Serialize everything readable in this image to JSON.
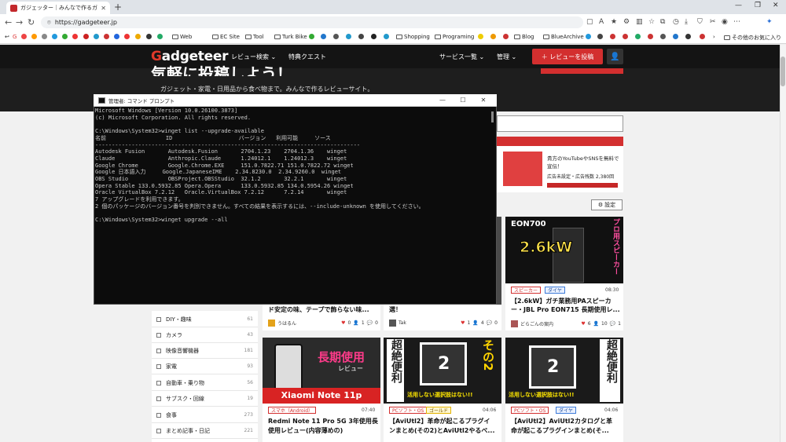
{
  "browser": {
    "tab_title": "ガジェッター｜みんなで作るガジェットレビ",
    "url": "https://gadgeteer.jp",
    "bookmarks": [
      "Web",
      "EC Site",
      "Tool",
      "Turk Bike",
      "Shopping",
      "Programing",
      "Blog",
      "BlueArchive",
      "その他のお気に入り"
    ]
  },
  "site": {
    "logo_g": "G",
    "logo_rest": "adgeteer",
    "nav": [
      "レビュー検索 ⌄",
      "特典クエスト",
      "サービス一覧 ⌄",
      "管理 ⌄"
    ],
    "post_button": "＋ レビューを投稿",
    "hero_title": "気軽に投稿しよう！",
    "hero_sub": "ガジェット・家電・日用品から食べ物まで。みんなで作るレビューサイト。",
    "ad_text": "貴方のYouTubeやSNSを無料で宣伝！",
    "ad_sub": "広告未設定・広告残数 2,380回",
    "settings": "設定"
  },
  "categories": [
    {
      "label": "DIY・趣味",
      "count": "61"
    },
    {
      "label": "カメラ",
      "count": "43"
    },
    {
      "label": "映像音響機器",
      "count": "181"
    },
    {
      "label": "家電",
      "count": "93"
    },
    {
      "label": "自動車・乗り物",
      "count": "56"
    },
    {
      "label": "サブスク・回線",
      "count": "19"
    },
    {
      "label": "食事",
      "count": "273"
    },
    {
      "label": "まとめ記事・日記",
      "count": "221"
    }
  ],
  "cards": [
    {
      "thumb": "",
      "title": "ド安定の味、テープで飾らない味...",
      "author": "うはるん",
      "likes": "0",
      "people": "1",
      "comments": "0"
    },
    {
      "thumb": "",
      "title": "選！",
      "author": "Tak",
      "likes": "1",
      "people": "4",
      "comments": "0"
    },
    {
      "thumb_top": "EON700",
      "thumb_big": "2.6kW",
      "thumb_side": "プロ用スピーカー",
      "badges": [
        "スピーカー",
        "ダイヤ"
      ],
      "time": "08:30",
      "title1": "【2.6kW】ガチ業務用PAスピーカ",
      "title2": "ー・JBL Pro EON715 長期使用レ...",
      "author": "どらごんの案内",
      "likes": "6",
      "people": "10",
      "comments": "1"
    },
    {
      "thumb_text1": "長期使用",
      "thumb_text2": "レビュー",
      "thumb_text3": "Xiaomi Note 11p",
      "badges": [
        "スマホ（Android）"
      ],
      "time": "07:40",
      "title1": "Redmi Note 11 Pro 5G 3年使用長期",
      "title2": "使用レビュー(内容薄めの)"
    },
    {
      "thumb_left": "超絶便利",
      "thumb_right": "その2",
      "thumb_num": "2",
      "thumb_bottom": "活用しない選択肢はない!!",
      "badges": [
        "PCソフト・OS",
        "ゴールド"
      ],
      "time": "04:06",
      "title1": "【AviUtl2】革命が起こるプラグイ",
      "title2": "ンまとめ(その2)とAviUtl2やるべ..."
    },
    {
      "thumb_left": "活用しない選択肢はない!!",
      "thumb_right": "超絶便利",
      "thumb_num": "2",
      "badges": [
        "PCソフト・OS",
        "ダイヤ"
      ],
      "time": "04:06",
      "title1": "【AviUtl2】AviUtl2カタログと革",
      "title2": "命が起こるプラグインまとめ(そ..."
    }
  ],
  "cmd": {
    "title": "管理者: コマンド プロンプト",
    "lines": [
      "Microsoft Windows [Version 10.0.26100.3873]",
      "(c) Microsoft Corporation. All rights reserved.",
      "",
      "C:\\Windows\\System32>winget list --upgrade-available",
      "名前                  ID                    バージョン   利用可能     ソース",
      "--------------------------------------------------------------------------------",
      "Autodesk Fusion       Autodesk.Fusion       2704.1.23    2704.1.36    winget",
      "Claude                Anthropic.Claude      1.24012.1    1.24012.3    winget",
      "Google Chrome         Google.Chrome.EXE     151.0.7822.71 151.0.7822.72 winget",
      "Google 日本語入力     Google.JapaneseIME    2.34.8230.0  2.34.9260.0  winget",
      "OBS Studio            OBSProject.OBSStudio  32.1.2       32.2.1       winget",
      "Opera Stable 133.0.5932.85 Opera.Opera      133.0.5932.85 134.0.5954.26 winget",
      "Oracle VirtualBox 7.2.12   Oracle.VirtualBox 7.2.12      7.2.14       winget",
      "7 アップグレードを利用できます。",
      "2 個のパッケージのバージョン番号を判別できません。すべての結果を表示するには、--include-unknown を使用してください。",
      "",
      "C:\\Windows\\System32>winget upgrade --all"
    ]
  }
}
